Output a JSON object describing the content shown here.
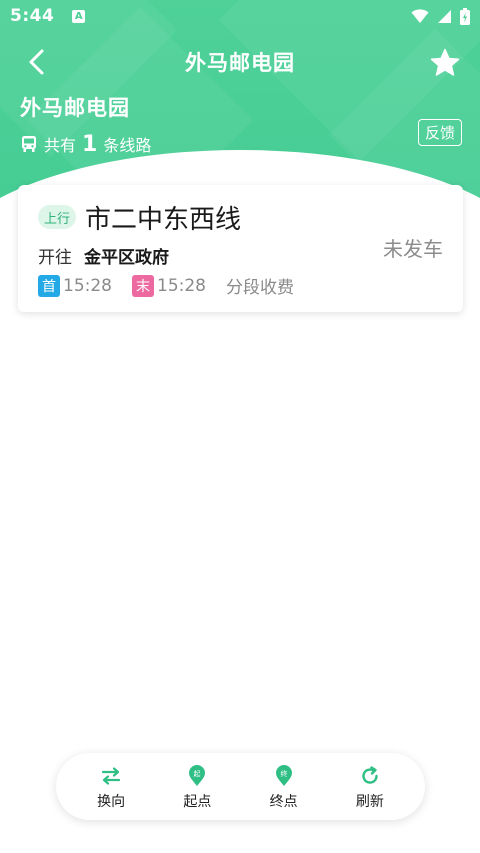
{
  "status_bar": {
    "time": "5:44",
    "a_label": "A"
  },
  "nav": {
    "title": "外马邮电园",
    "back_icon": "chevron-left-icon",
    "favorite_icon": "star-icon"
  },
  "stop": {
    "name": "外马邮电园",
    "route_prefix": "共有",
    "route_count": "1",
    "route_suffix": "条线路",
    "feedback_label": "反馈"
  },
  "routes": [
    {
      "direction": "上行",
      "name": "市二中东西线",
      "toward_label": "开往",
      "destination": "金平区政府",
      "first_tag": "首",
      "first_time": "15:28",
      "last_tag": "末",
      "last_time": "15:28",
      "fare": "分段收费",
      "status": "未发车"
    }
  ],
  "bottom_bar": {
    "items": [
      {
        "label": "换向",
        "icon": "swap-icon"
      },
      {
        "label": "起点",
        "icon": "start-pin-icon"
      },
      {
        "label": "终点",
        "icon": "end-pin-icon"
      },
      {
        "label": "刷新",
        "icon": "refresh-icon"
      }
    ]
  },
  "colors": {
    "brand": "#49cf96",
    "first_tag": "#23a9e6",
    "last_tag": "#ec6aa0",
    "badge_bg": "#def5ea",
    "badge_text": "#2fb27a"
  }
}
